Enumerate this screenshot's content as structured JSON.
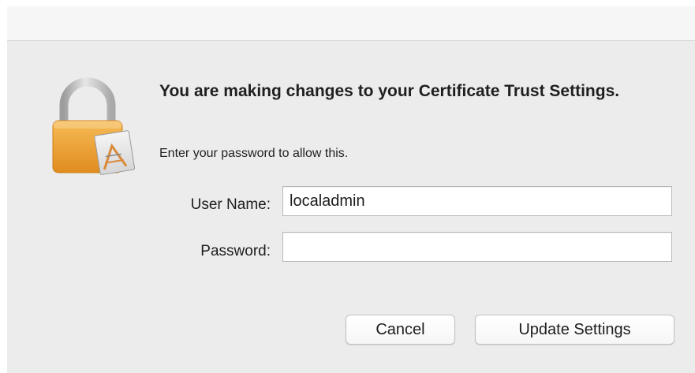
{
  "dialog": {
    "title": "You are making changes to your Certificate Trust Settings.",
    "subtitle": "Enter your password to allow this.",
    "icon": "padlock-certificate-icon"
  },
  "form": {
    "username_label": "User Name:",
    "username_value": "localadmin",
    "password_label": "Password:",
    "password_value": ""
  },
  "buttons": {
    "cancel_label": "Cancel",
    "update_label": "Update Settings"
  },
  "colors": {
    "window_background": "#ececec",
    "lock_body": "#f3a63a",
    "lock_shackle": "#c9c9c9"
  }
}
